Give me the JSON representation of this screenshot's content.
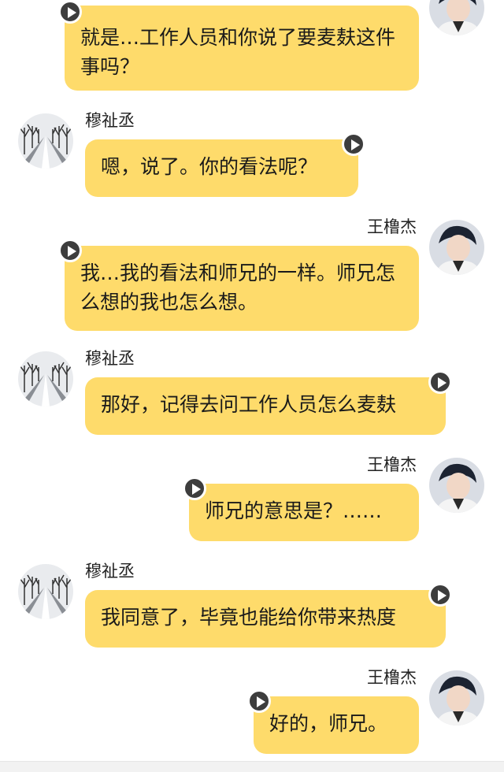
{
  "messages": [
    {
      "sender": "王橹杰",
      "side": "right",
      "text": "就是…工作人员和你说了要麦麸这件事吗？",
      "name_visible": false
    },
    {
      "sender": "穆祉丞",
      "side": "left",
      "text": "嗯，说了。你的看法呢？",
      "name_visible": true
    },
    {
      "sender": "王橹杰",
      "side": "right",
      "text": "我…我的看法和师兄的一样。师兄怎么想的我也怎么想。",
      "name_visible": true
    },
    {
      "sender": "穆祉丞",
      "side": "left",
      "text": "那好，记得去问工作人员怎么麦麸",
      "name_visible": true
    },
    {
      "sender": "王橹杰",
      "side": "right",
      "text": "师兄的意思是？……",
      "name_visible": true
    },
    {
      "sender": "穆祉丞",
      "side": "left",
      "text": "我同意了，毕竟也能给你带来热度",
      "name_visible": true
    },
    {
      "sender": "王橹杰",
      "side": "right",
      "text": "好的，师兄。",
      "name_visible": true
    }
  ],
  "colors": {
    "bubble": "#fedb6b",
    "play_button": "#3d3d3d",
    "background": "#ffffff"
  },
  "icons": {
    "play": "play-icon",
    "left_avatar": "snowy-road-avatar",
    "right_avatar": "person-avatar"
  }
}
